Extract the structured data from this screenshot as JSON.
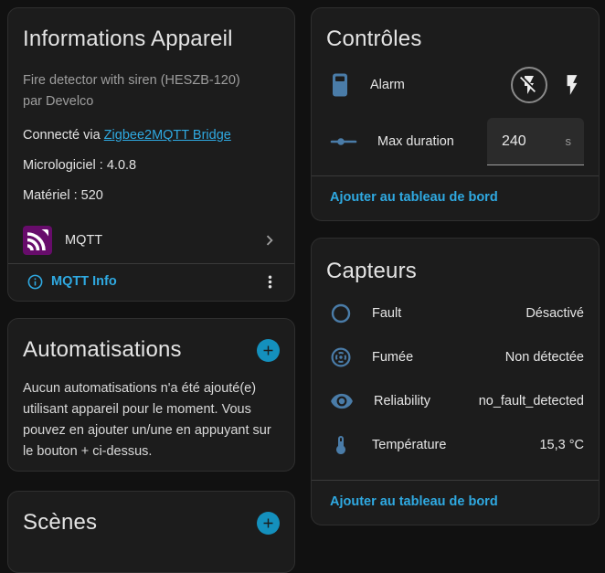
{
  "colors": {
    "page_bg": "#111111",
    "card_bg": "#1c1c1c",
    "accent_link": "#2fa9e1",
    "icon_blue": "#4a7ca8",
    "plus_button": "#1490bd",
    "mqtt_purple": "#670c6b"
  },
  "device_info": {
    "title": "Informations Appareil",
    "model_line1": "Fire detector with siren (HESZB-120)",
    "model_line2": "par Develco",
    "connected_via_label": "Connecté via",
    "connected_via_link": "Zigbee2MQTT Bridge",
    "firmware": "Micrologiciel : 4.0.8",
    "hardware": "Matériel : 520",
    "integration_name": "MQTT",
    "mqtt_info_label": "MQTT Info"
  },
  "automations": {
    "title": "Automatisations",
    "empty_text": "Aucun automatisations n'a été ajouté(e) utilisant appareil pour le moment. Vous pouvez en ajouter un/une en appuyant sur le bouton + ci-dessus."
  },
  "scenes": {
    "title": "Scènes"
  },
  "controls": {
    "title": "Contrôles",
    "alarm": {
      "label": "Alarm"
    },
    "max_duration": {
      "label": "Max duration",
      "value": "240",
      "unit": "s"
    },
    "add_to_dashboard": "Ajouter au tableau de bord"
  },
  "sensors": {
    "title": "Capteurs",
    "rows": [
      {
        "icon": "circle-outline-icon",
        "label": "Fault",
        "value": "Désactivé"
      },
      {
        "icon": "smoke-detector-icon",
        "label": "Fumée",
        "value": "Non détectée"
      },
      {
        "icon": "eye-icon",
        "label": "Reliability",
        "value": "no_fault_detected"
      },
      {
        "icon": "thermometer-icon",
        "label": "Température",
        "value": "15,3 °C"
      }
    ],
    "add_to_dashboard": "Ajouter au tableau de bord"
  }
}
